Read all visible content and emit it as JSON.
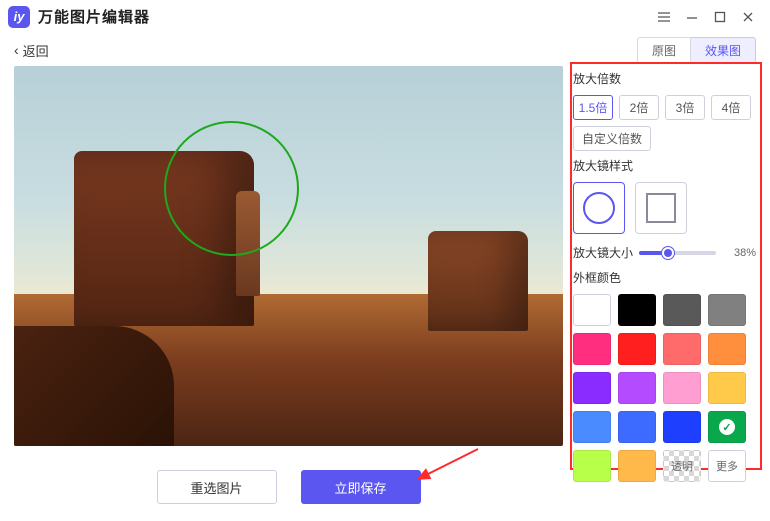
{
  "app": {
    "title": "万能图片编辑器"
  },
  "toolbar": {
    "back": "返回",
    "tabs": {
      "original": "原图",
      "result": "效果图"
    }
  },
  "buttons": {
    "reselect": "重选图片",
    "save": "立即保存"
  },
  "panel": {
    "zoom_title": "放大倍数",
    "zoom_options": [
      "1.5倍",
      "2倍",
      "3倍",
      "4倍"
    ],
    "zoom_custom": "自定义倍数",
    "style_title": "放大镜样式",
    "size_label": "放大镜大小",
    "size_percent": "38%",
    "color_title": "外框颜色",
    "swatches": [
      "#ffffff",
      "#000000",
      "#595959",
      "#808080",
      "#ff2e7e",
      "#ff1f1f",
      "#ff6b6b",
      "#ff8f3d",
      "#8a2bff",
      "#b44bff",
      "#ff9ed0",
      "#ffc94a",
      "#4a8bff",
      "#3d6bff",
      "#1f3fff",
      "#09a84d",
      "#b8ff4a",
      "#ffb84a"
    ],
    "transparent_label": "透明",
    "more_label": "更多"
  }
}
